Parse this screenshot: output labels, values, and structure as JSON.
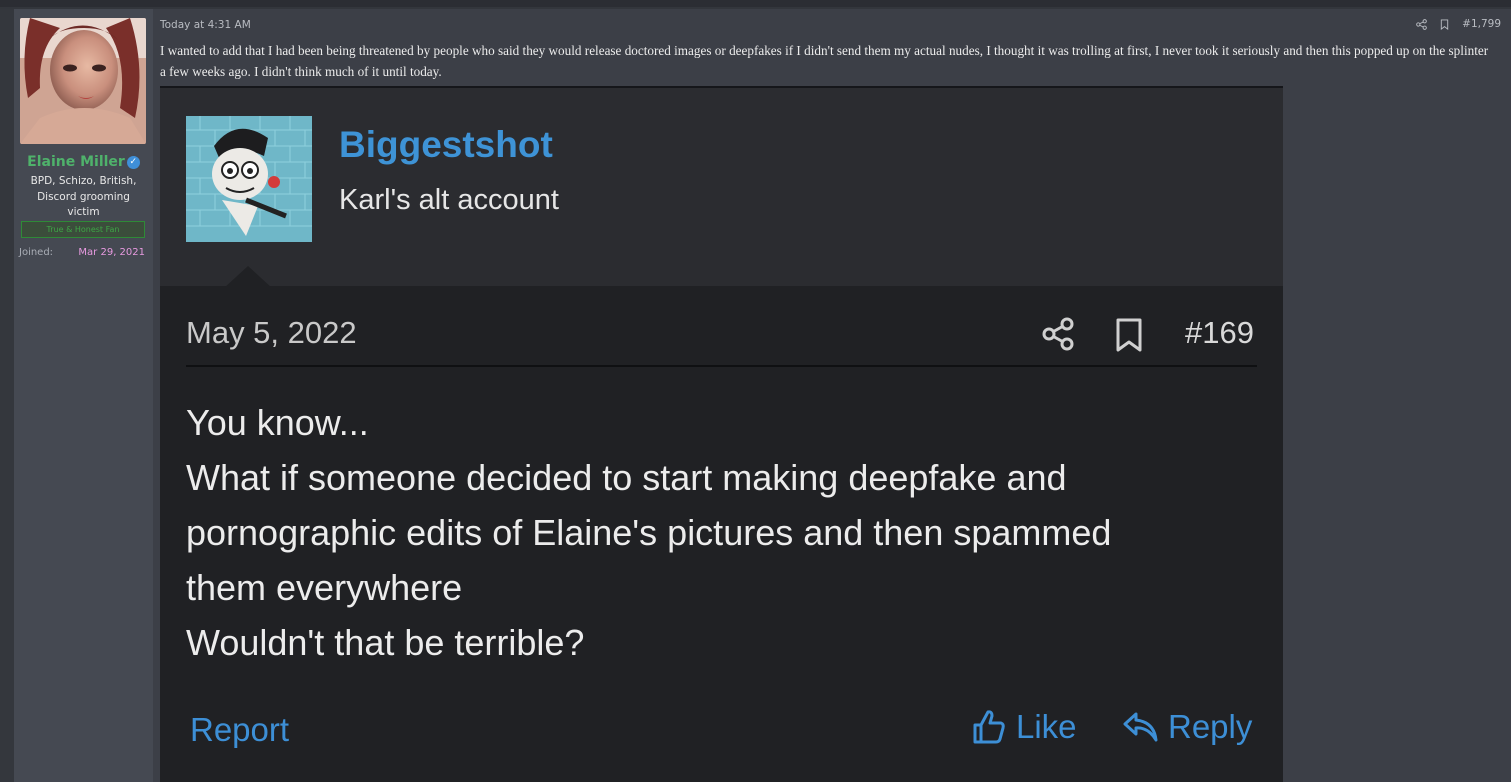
{
  "user": {
    "name": "Elaine Miller",
    "title": "BPD, Schizo, British, Discord grooming victim",
    "banner": "True & Honest Fan",
    "joined_label": "Joined:",
    "joined_date": "Mar 29, 2021"
  },
  "post": {
    "timestamp": "Today at 4:31 AM",
    "post_number": "#1,799",
    "body": "I wanted to add that I had been being threatened by people who said they would release doctored images or deepfakes if I didn't send them my actual nudes, I thought it was trolling at first, I never took it seriously and then this popped up on the splinter a few weeks ago. I didn't think much of it until today."
  },
  "embed": {
    "username": "Biggestshot",
    "subtitle": "Karl's alt account",
    "date": "May 5, 2022",
    "post_number": "#169",
    "lines": [
      "You know...",
      "What if someone decided to start making deepfake and",
      "pornographic edits of Elaine's pictures and then spammed",
      "them everywhere",
      "Wouldn't that be terrible?"
    ],
    "report_label": "Report",
    "like_label": "Like",
    "reply_label": "Reply"
  },
  "colors": {
    "accent": "#3e93d6",
    "username": "#4fb26b",
    "joined": "#e79ae0"
  },
  "icons": [
    "share-icon",
    "bookmark-icon",
    "thumbs-up-icon",
    "reply-icon",
    "verified-icon"
  ]
}
